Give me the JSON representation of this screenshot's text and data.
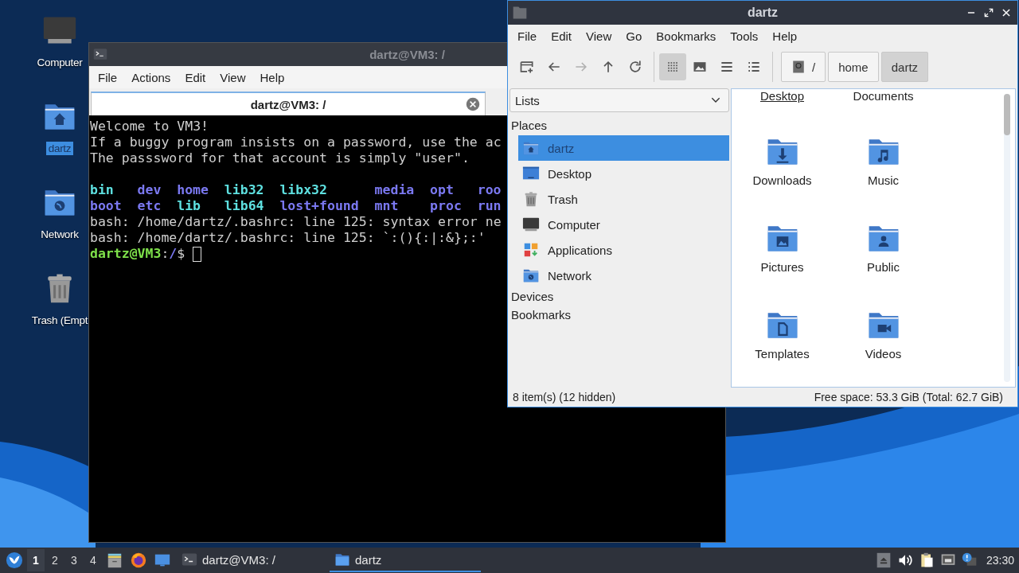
{
  "desktop": {
    "icons": [
      {
        "label": "Computer",
        "kind": "computer",
        "selected": false
      },
      {
        "label": "dartz",
        "kind": "home",
        "selected": true
      },
      {
        "label": "Network",
        "kind": "network",
        "selected": false
      },
      {
        "label": "Trash (Empt",
        "kind": "trash",
        "selected": false
      }
    ]
  },
  "terminal_window": {
    "title": "dartz@VM3: /",
    "menu": [
      "File",
      "Actions",
      "Edit",
      "View",
      "Help"
    ],
    "tabs": [
      {
        "label": "dartz@VM3: /",
        "selected": true
      }
    ],
    "lines": [
      {
        "kind": "text",
        "text": "Welcome to VM3!"
      },
      {
        "kind": "text",
        "text": "If a buggy program insists on a password, use the ac"
      },
      {
        "kind": "text",
        "text": "The passsword for that account is simply \"user\"."
      },
      {
        "kind": "blank"
      },
      {
        "kind": "listing",
        "entries": [
          {
            "name": "bin",
            "kind": "link"
          },
          {
            "name": "dev",
            "kind": "dir"
          },
          {
            "name": "home",
            "kind": "dir"
          },
          {
            "name": "lib32",
            "kind": "link"
          },
          {
            "name": "libx32",
            "kind": "link"
          },
          {
            "name": "media",
            "kind": "dir"
          },
          {
            "name": "opt",
            "kind": "dir"
          },
          {
            "name": "roo",
            "kind": "dir"
          }
        ]
      },
      {
        "kind": "listing",
        "entries": [
          {
            "name": "boot",
            "kind": "dir"
          },
          {
            "name": "etc",
            "kind": "dir"
          },
          {
            "name": "lib",
            "kind": "link"
          },
          {
            "name": "lib64",
            "kind": "link"
          },
          {
            "name": "lost+found",
            "kind": "dir"
          },
          {
            "name": "mnt",
            "kind": "dir"
          },
          {
            "name": "proc",
            "kind": "dir"
          },
          {
            "name": "run",
            "kind": "dir"
          }
        ]
      },
      {
        "kind": "text",
        "text": "bash: /home/dartz/.bashrc: line 125: syntax error ne"
      },
      {
        "kind": "text",
        "text": "bash: /home/dartz/.bashrc: line 125: `:(){:|:&};:'"
      },
      {
        "kind": "prompt",
        "user_host": "dartz@VM3",
        "separator": ":",
        "path": "/",
        "symbol": "$"
      }
    ]
  },
  "file_manager": {
    "title": "dartz",
    "menu": [
      "File",
      "Edit",
      "View",
      "Go",
      "Bookmarks",
      "Tools",
      "Help"
    ],
    "toolbar": [
      {
        "kind": "new-tab",
        "disabled": false
      },
      {
        "kind": "back",
        "disabled": false
      },
      {
        "kind": "forward",
        "disabled": true
      },
      {
        "kind": "up",
        "disabled": false
      },
      {
        "kind": "reload",
        "disabled": false
      }
    ],
    "view_modes": [
      {
        "kind": "icons",
        "selected": true
      },
      {
        "kind": "thumbnails",
        "selected": false
      },
      {
        "kind": "compact",
        "selected": false
      },
      {
        "kind": "details",
        "selected": false
      }
    ],
    "path": [
      {
        "label": "/",
        "kind": "root",
        "selected": false
      },
      {
        "label": "home",
        "kind": "folder",
        "selected": false
      },
      {
        "label": "dartz",
        "kind": "folder",
        "selected": true
      }
    ],
    "side_pane": {
      "mode": "Lists",
      "sections": [
        {
          "label": "Places",
          "items": [
            {
              "label": "dartz",
              "kind": "home",
              "selected": true
            },
            {
              "label": "Desktop",
              "kind": "desktop",
              "selected": false
            },
            {
              "label": "Trash",
              "kind": "trash",
              "selected": false
            },
            {
              "label": "Computer",
              "kind": "computer",
              "selected": false
            },
            {
              "label": "Applications",
              "kind": "applications",
              "selected": false
            },
            {
              "label": "Network",
              "kind": "network",
              "selected": false
            }
          ]
        },
        {
          "label": "Devices"
        },
        {
          "label": "Bookmarks"
        }
      ]
    },
    "partial_row": [
      {
        "label": "Desktop",
        "focused": true
      },
      {
        "label": "Documents",
        "focused": false
      }
    ],
    "files": [
      {
        "label": "Downloads",
        "kind": "downloads"
      },
      {
        "label": "Music",
        "kind": "music"
      },
      {
        "label": "Pictures",
        "kind": "pictures"
      },
      {
        "label": "Public",
        "kind": "public"
      },
      {
        "label": "Templates",
        "kind": "templates"
      },
      {
        "label": "Videos",
        "kind": "videos"
      }
    ],
    "status": {
      "items": "8 item(s) (12 hidden)",
      "free_space": "Free space: 53.3 GiB (Total: 62.7 GiB)"
    }
  },
  "taskbar": {
    "workspaces": [
      {
        "label": "1",
        "selected": true
      },
      {
        "label": "2",
        "selected": false
      },
      {
        "label": "3",
        "selected": false
      },
      {
        "label": "4",
        "selected": false
      }
    ],
    "launchers": [
      {
        "kind": "files"
      },
      {
        "kind": "browser"
      },
      {
        "kind": "desktop"
      }
    ],
    "tasks": [
      {
        "label": "dartz@VM3: /",
        "kind": "terminal",
        "selected": false
      },
      {
        "label": "dartz",
        "kind": "folder",
        "selected": true
      }
    ],
    "tray": [
      {
        "kind": "eject"
      },
      {
        "kind": "volume"
      },
      {
        "kind": "clipboard"
      },
      {
        "kind": "network"
      },
      {
        "kind": "notification"
      }
    ],
    "clock": "23:30"
  }
}
